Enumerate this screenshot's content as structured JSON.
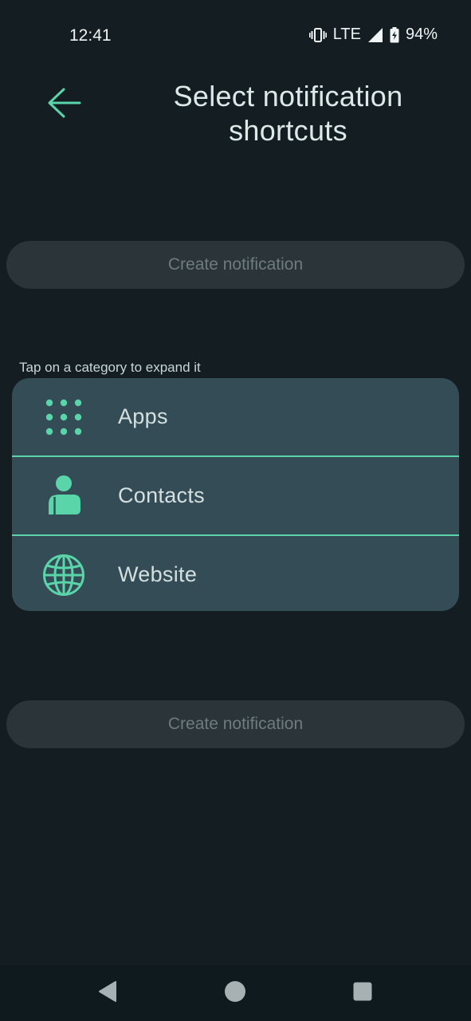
{
  "status_bar": {
    "time": "12:41",
    "network": "LTE",
    "battery": "94%",
    "icons": [
      "vibrate-icon",
      "signal-icon",
      "battery-charging-icon"
    ]
  },
  "header": {
    "back_icon": "arrow-left-icon",
    "title": "Select notification shortcuts"
  },
  "create_button_label": "Create notification",
  "hint": "Tap on a category to expand it",
  "categories": [
    {
      "label": "Apps",
      "icon": "apps-grid-icon"
    },
    {
      "label": "Contacts",
      "icon": "person-icon"
    },
    {
      "label": "Website",
      "icon": "globe-icon"
    }
  ],
  "nav_bar": {
    "icons": [
      "back-triangle-icon",
      "home-circle-icon",
      "recents-square-icon"
    ]
  },
  "colors": {
    "background": "#131d22",
    "accent": "#5ad4a9",
    "card": "#344c55",
    "button_disabled_bg": "#2a3439",
    "button_disabled_text": "#6f7b7f"
  }
}
